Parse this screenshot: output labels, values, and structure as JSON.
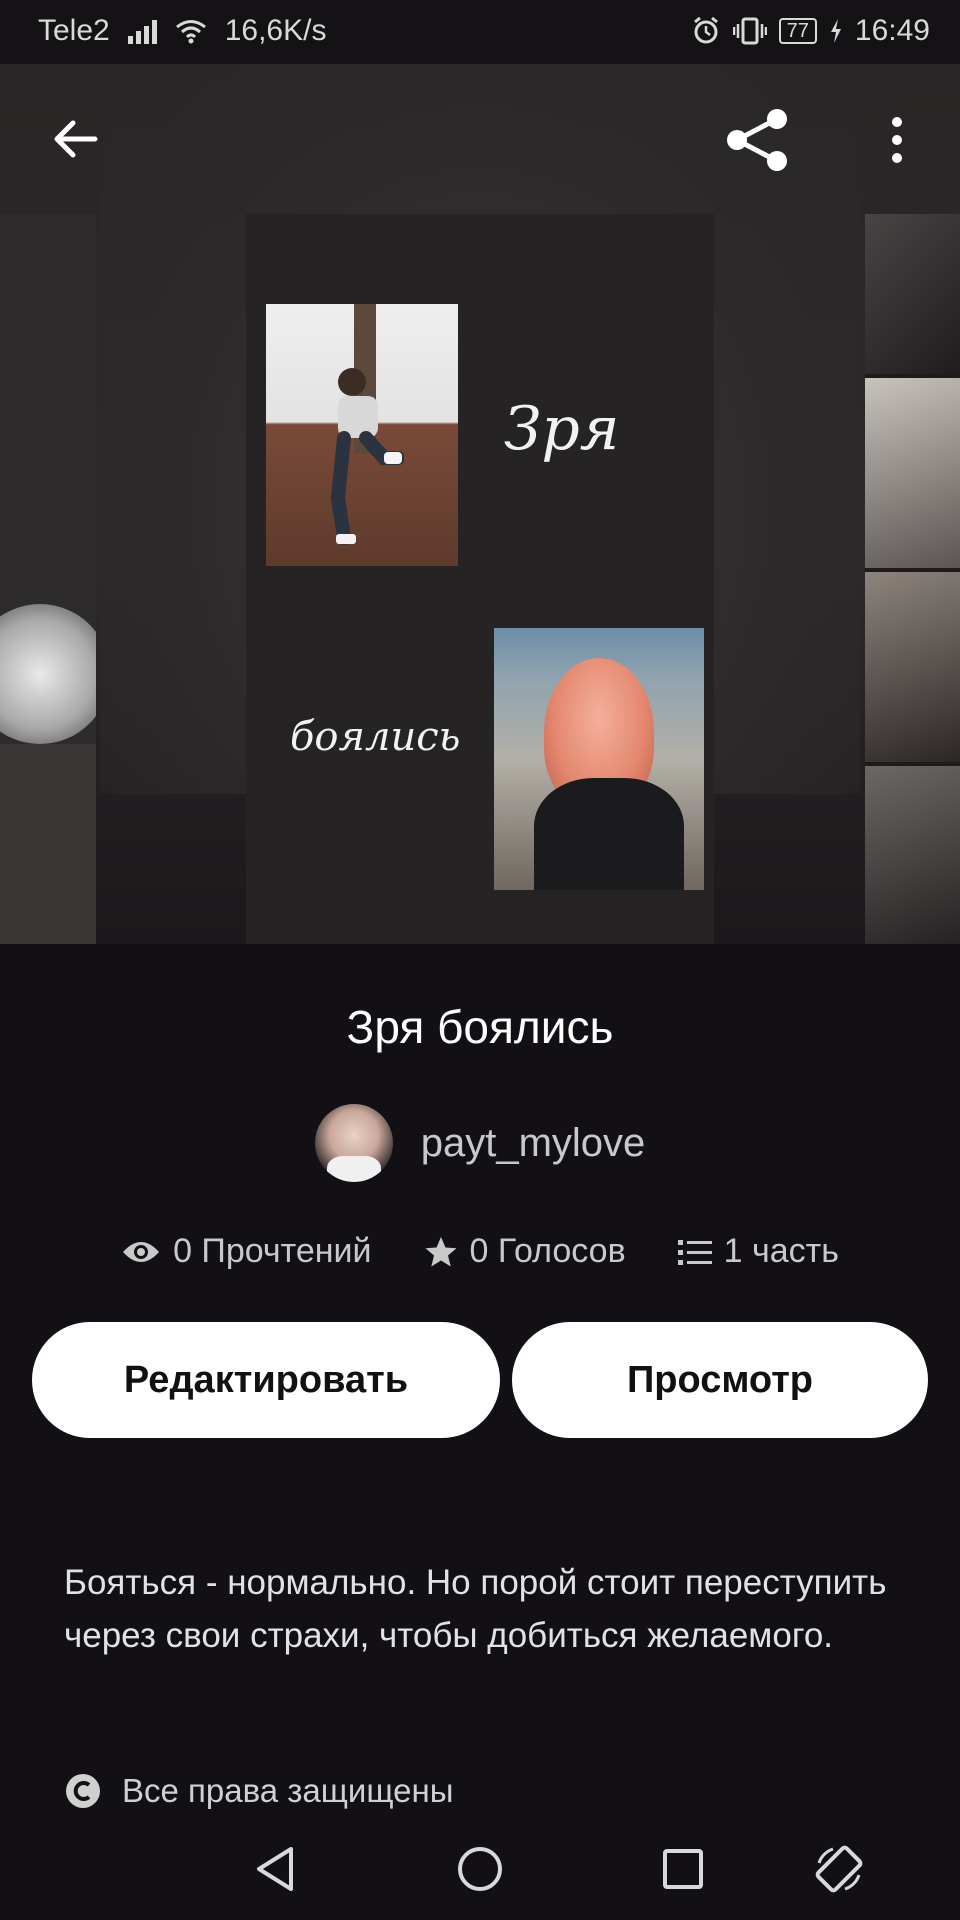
{
  "status_bar": {
    "carrier": "Tele2",
    "speed": "16,6K/s",
    "battery": "77",
    "time": "16:49",
    "icons": [
      "signal-icon",
      "wifi-icon",
      "alarm-icon",
      "vibrate-icon",
      "battery-icon",
      "charging-icon"
    ]
  },
  "toolbar": {
    "icons": [
      "back-arrow-icon",
      "share-icon",
      "more-vert-icon"
    ]
  },
  "cover": {
    "line1": "Зря",
    "line2": "боялись"
  },
  "story": {
    "title": "Зря боялись",
    "author": "payt_mylove",
    "reads": "0 Прочтений",
    "votes": "0 Голосов",
    "parts": "1 часть",
    "description": "Бояться - нормально. Но порой стоит переступить через свои страхи, чтобы добиться желаемого.",
    "rights": "Все права защищены"
  },
  "buttons": {
    "edit": "Редактировать",
    "preview": "Просмотр"
  },
  "nav_bar": {
    "icons": [
      "nav-back-icon",
      "nav-home-icon",
      "nav-recents-icon",
      "rotate-icon"
    ]
  },
  "colors": {
    "background": "#121014",
    "button_bg": "#ffffff",
    "text_muted": "#c9c9c9"
  }
}
